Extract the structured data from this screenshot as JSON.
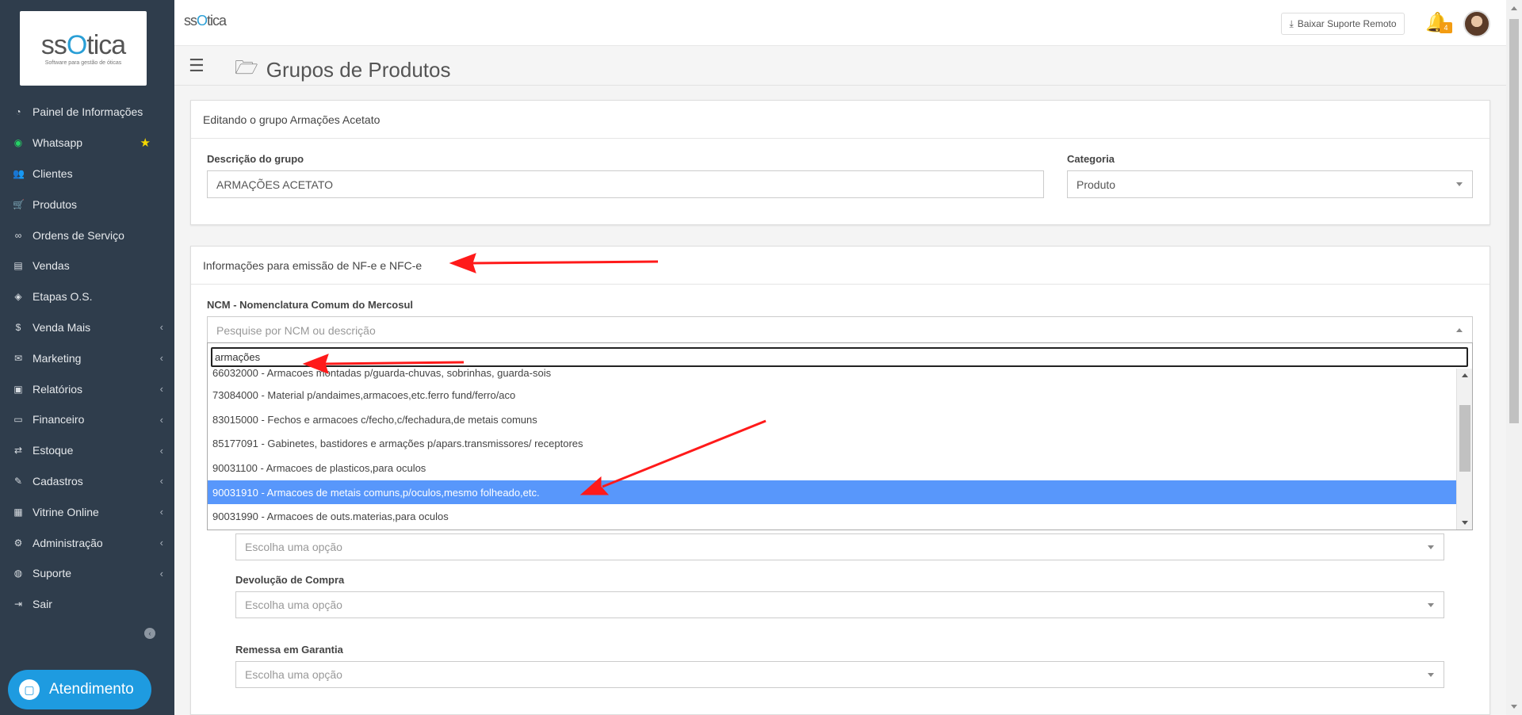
{
  "brand": {
    "logo_text_pre": "ss",
    "logo_text_o": "O",
    "logo_text_post": "tica",
    "tagline": "Software para gestão de óticas"
  },
  "sidebar": {
    "items": [
      {
        "label": "Painel de Informações",
        "icon": "dashboard-icon",
        "glyph": "◔"
      },
      {
        "label": "Whatsapp",
        "icon": "whatsapp-icon",
        "glyph": "◉"
      },
      {
        "label": "Clientes",
        "icon": "users-icon",
        "glyph": "👥"
      },
      {
        "label": "Produtos",
        "icon": "cart-icon",
        "glyph": "🛒"
      },
      {
        "label": "Ordens de Serviço",
        "icon": "glasses-icon",
        "glyph": "∞"
      },
      {
        "label": "Vendas",
        "icon": "register-icon",
        "glyph": "▤"
      },
      {
        "label": "Etapas O.S.",
        "icon": "tag-icon",
        "glyph": "◈"
      },
      {
        "label": "Venda Mais",
        "icon": "dollar-icon",
        "glyph": "$"
      },
      {
        "label": "Marketing",
        "icon": "comments-icon",
        "glyph": "✉"
      },
      {
        "label": "Relatórios",
        "icon": "report-icon",
        "glyph": "▣"
      },
      {
        "label": "Financeiro",
        "icon": "money-icon",
        "glyph": "▭"
      },
      {
        "label": "Estoque",
        "icon": "exchange-icon",
        "glyph": "⇄"
      },
      {
        "label": "Cadastros",
        "icon": "edit-icon",
        "glyph": "✎"
      },
      {
        "label": "Vitrine Online",
        "icon": "store-icon",
        "glyph": "▦"
      },
      {
        "label": "Administração",
        "icon": "cogs-icon",
        "glyph": "⚙"
      },
      {
        "label": "Suporte",
        "icon": "globe-icon",
        "glyph": "◍"
      },
      {
        "label": "Sair",
        "icon": "sign-out-icon",
        "glyph": "⇥"
      }
    ],
    "atendimento_label": "Atendimento"
  },
  "topbar": {
    "remote_button_label": "Baixar Suporte Remoto",
    "notification_count": "4"
  },
  "page": {
    "title": "Grupos de Produtos"
  },
  "group_panel": {
    "heading": "Editando o grupo Armações Acetato",
    "description_label": "Descrição do grupo",
    "description_value": "ARMAÇÕES ACETATO",
    "category_label": "Categoria",
    "category_value": "Produto"
  },
  "nf_panel": {
    "heading": "Informações para emissão de NF-e e NFC-e",
    "ncm_label": "NCM - Nomenclatura Comum do Mercosul",
    "ncm_placeholder": "Pesquise por NCM ou descrição",
    "search_value": "armações",
    "options": [
      "66032000 - Armacoes montadas p/guarda-chuvas, sobrinhas, guarda-sois",
      "73084000 - Material p/andaimes,armacoes,etc.ferro fund/ferro/aco",
      "83015000 - Fechos e armacoes c/fecho,c/fechadura,de metais comuns",
      "85177091 - Gabinetes, bastidores e armações p/apars.transmissores/ receptores",
      "90031100 - Armacoes de plasticos,para oculos",
      "90031910 - Armacoes de metais comuns,p/oculos,mesmo folheado,etc.",
      "90031990 - Armacoes de outs.materias,para oculos"
    ],
    "selected_option": "90031910 - Armacoes de metais comuns,p/oculos,mesmo folheado,etc.",
    "select_placeholder": "Escolha uma opção",
    "devolucao_label": "Devolução de Compra",
    "remessa_label": "Remessa em Garantia"
  },
  "colors": {
    "sidebar_bg": "#2f3d4c",
    "accent": "#2a9fd6",
    "selected": "#5897fb",
    "annotation_arrow": "#ff1a1a"
  }
}
